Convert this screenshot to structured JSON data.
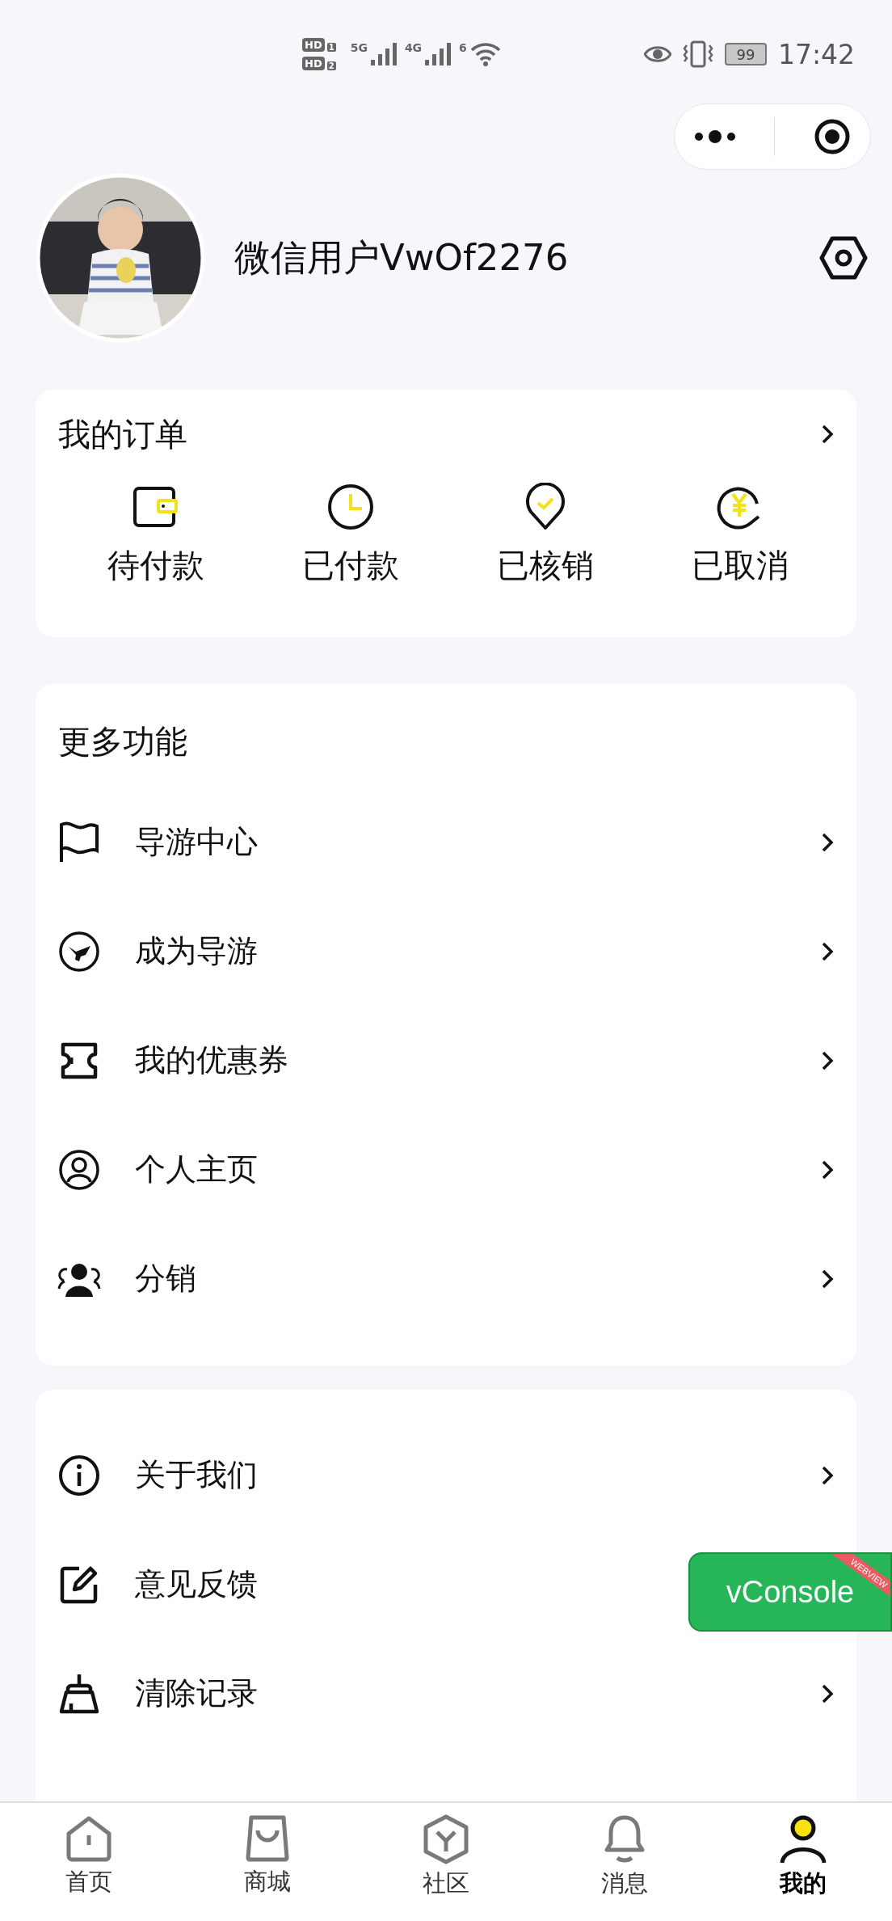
{
  "status_bar": {
    "sims": [
      {
        "badge": "HD",
        "slot": "1"
      },
      {
        "badge": "HD",
        "slot": "2"
      }
    ],
    "networks": [
      {
        "label": "5G"
      },
      {
        "label": "4G"
      }
    ],
    "wifi_label": "6",
    "battery": "99",
    "time": "17:42"
  },
  "profile": {
    "username": "微信用户VwOf2276"
  },
  "orders": {
    "title": "我的订单",
    "items": [
      {
        "label": "待付款",
        "kind": "wallet"
      },
      {
        "label": "已付款",
        "kind": "clock"
      },
      {
        "label": "已核销",
        "kind": "pin"
      },
      {
        "label": "已取消",
        "kind": "refund"
      }
    ]
  },
  "features": {
    "title": "更多功能",
    "items": [
      {
        "label": "导游中心",
        "kind": "flag"
      },
      {
        "label": "成为导游",
        "kind": "guide"
      },
      {
        "label": "我的优惠券",
        "kind": "ticket"
      },
      {
        "label": "个人主页",
        "kind": "person"
      },
      {
        "label": "分销",
        "kind": "group"
      }
    ]
  },
  "more": {
    "items": [
      {
        "label": "关于我们",
        "kind": "info",
        "chevron": true
      },
      {
        "label": "意见反馈",
        "kind": "edit",
        "chevron": false
      },
      {
        "label": "清除记录",
        "kind": "broom",
        "chevron": true
      }
    ]
  },
  "vconsole": {
    "label": "vConsole",
    "ribbon": "WEBVIEW"
  },
  "tabs": [
    {
      "label": "首页",
      "kind": "home",
      "selected": false
    },
    {
      "label": "商城",
      "kind": "bag",
      "selected": false
    },
    {
      "label": "社区",
      "kind": "hex",
      "selected": false
    },
    {
      "label": "消息",
      "kind": "bell",
      "selected": false
    },
    {
      "label": "我的",
      "kind": "me",
      "selected": true
    }
  ]
}
